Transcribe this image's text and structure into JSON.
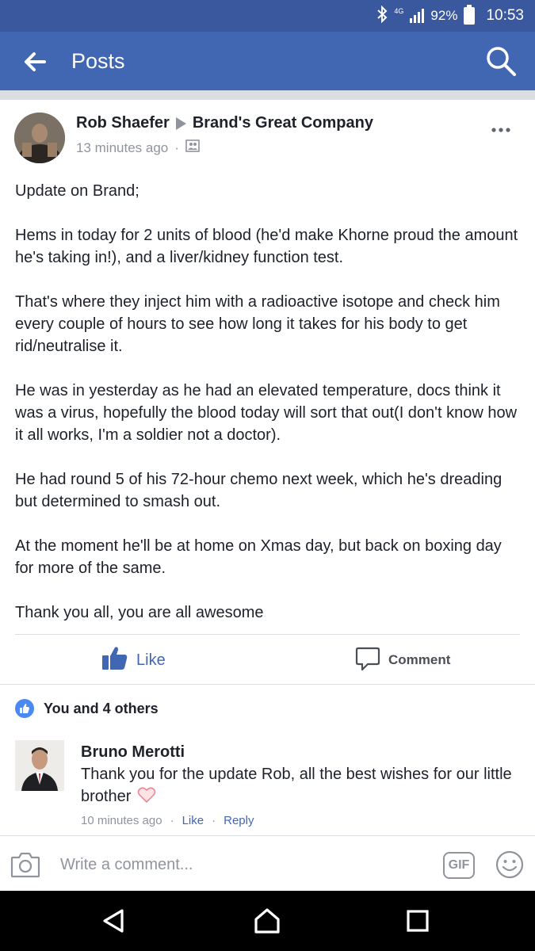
{
  "status_bar": {
    "network": "4G",
    "battery": "92%",
    "time": "10:53"
  },
  "app_bar": {
    "title": "Posts"
  },
  "post": {
    "author": "Rob Shaefer",
    "target": "Brand's Great Company",
    "timestamp": "13 minutes ago",
    "separator": "·",
    "paragraphs": [
      "Update on Brand;",
      "Hems in today for 2 units of blood (he'd make Khorne proud the amount he's taking in!), and a liver/kidney function test.",
      "That's where they inject him with a radioactive isotope and check him every couple of hours to see how long it takes for his body to get rid/neutralise it.",
      "He was in yesterday as he had an elevated temperature, docs think it was a virus, hopefully the blood today will sort that out(I don't know how it all works, I'm a soldier not a doctor).",
      "He had round 5 of his 72-hour chemo next week, which he's dreading but determined to smash out.",
      "At the moment he'll be at home on Xmas day, but back on boxing day for more of the same.",
      "Thank you all, you are all awesome"
    ],
    "like_label": "Like",
    "comment_label": "Comment",
    "reactions_text": "You and 4 others"
  },
  "comment": {
    "author": "Bruno Merotti",
    "text": "Thank you for the update Rob, all the best wishes for our little brother",
    "timestamp": "10 minutes ago",
    "separator": "·",
    "like_label": "Like",
    "reply_label": "Reply"
  },
  "composer": {
    "placeholder": "Write a comment...",
    "gif_label": "GIF"
  },
  "colors": {
    "status_bar": "#3a589d",
    "app_bar": "#4267b2",
    "like_blue": "#4267b2",
    "heart_pink": "#f0a0a8"
  }
}
